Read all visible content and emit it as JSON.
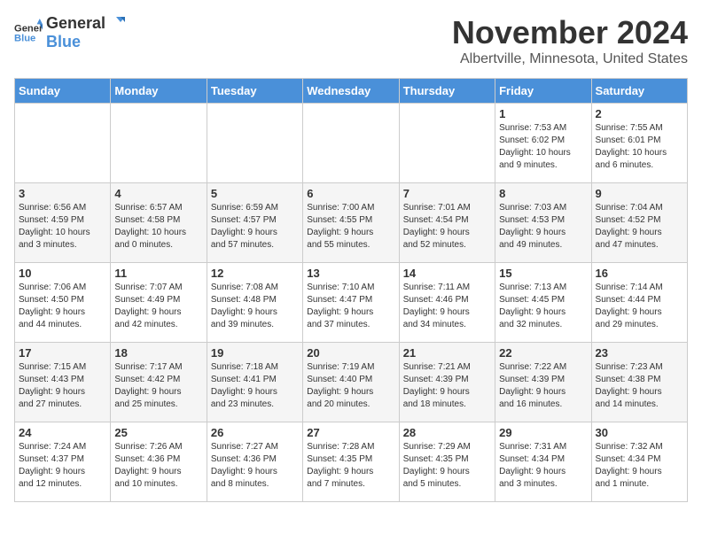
{
  "header": {
    "logo_general": "General",
    "logo_blue": "Blue",
    "month_title": "November 2024",
    "location": "Albertville, Minnesota, United States"
  },
  "days_of_week": [
    "Sunday",
    "Monday",
    "Tuesday",
    "Wednesday",
    "Thursday",
    "Friday",
    "Saturday"
  ],
  "weeks": [
    [
      {
        "day": "",
        "info": ""
      },
      {
        "day": "",
        "info": ""
      },
      {
        "day": "",
        "info": ""
      },
      {
        "day": "",
        "info": ""
      },
      {
        "day": "",
        "info": ""
      },
      {
        "day": "1",
        "info": "Sunrise: 7:53 AM\nSunset: 6:02 PM\nDaylight: 10 hours\nand 9 minutes."
      },
      {
        "day": "2",
        "info": "Sunrise: 7:55 AM\nSunset: 6:01 PM\nDaylight: 10 hours\nand 6 minutes."
      }
    ],
    [
      {
        "day": "3",
        "info": "Sunrise: 6:56 AM\nSunset: 4:59 PM\nDaylight: 10 hours\nand 3 minutes."
      },
      {
        "day": "4",
        "info": "Sunrise: 6:57 AM\nSunset: 4:58 PM\nDaylight: 10 hours\nand 0 minutes."
      },
      {
        "day": "5",
        "info": "Sunrise: 6:59 AM\nSunset: 4:57 PM\nDaylight: 9 hours\nand 57 minutes."
      },
      {
        "day": "6",
        "info": "Sunrise: 7:00 AM\nSunset: 4:55 PM\nDaylight: 9 hours\nand 55 minutes."
      },
      {
        "day": "7",
        "info": "Sunrise: 7:01 AM\nSunset: 4:54 PM\nDaylight: 9 hours\nand 52 minutes."
      },
      {
        "day": "8",
        "info": "Sunrise: 7:03 AM\nSunset: 4:53 PM\nDaylight: 9 hours\nand 49 minutes."
      },
      {
        "day": "9",
        "info": "Sunrise: 7:04 AM\nSunset: 4:52 PM\nDaylight: 9 hours\nand 47 minutes."
      }
    ],
    [
      {
        "day": "10",
        "info": "Sunrise: 7:06 AM\nSunset: 4:50 PM\nDaylight: 9 hours\nand 44 minutes."
      },
      {
        "day": "11",
        "info": "Sunrise: 7:07 AM\nSunset: 4:49 PM\nDaylight: 9 hours\nand 42 minutes."
      },
      {
        "day": "12",
        "info": "Sunrise: 7:08 AM\nSunset: 4:48 PM\nDaylight: 9 hours\nand 39 minutes."
      },
      {
        "day": "13",
        "info": "Sunrise: 7:10 AM\nSunset: 4:47 PM\nDaylight: 9 hours\nand 37 minutes."
      },
      {
        "day": "14",
        "info": "Sunrise: 7:11 AM\nSunset: 4:46 PM\nDaylight: 9 hours\nand 34 minutes."
      },
      {
        "day": "15",
        "info": "Sunrise: 7:13 AM\nSunset: 4:45 PM\nDaylight: 9 hours\nand 32 minutes."
      },
      {
        "day": "16",
        "info": "Sunrise: 7:14 AM\nSunset: 4:44 PM\nDaylight: 9 hours\nand 29 minutes."
      }
    ],
    [
      {
        "day": "17",
        "info": "Sunrise: 7:15 AM\nSunset: 4:43 PM\nDaylight: 9 hours\nand 27 minutes."
      },
      {
        "day": "18",
        "info": "Sunrise: 7:17 AM\nSunset: 4:42 PM\nDaylight: 9 hours\nand 25 minutes."
      },
      {
        "day": "19",
        "info": "Sunrise: 7:18 AM\nSunset: 4:41 PM\nDaylight: 9 hours\nand 23 minutes."
      },
      {
        "day": "20",
        "info": "Sunrise: 7:19 AM\nSunset: 4:40 PM\nDaylight: 9 hours\nand 20 minutes."
      },
      {
        "day": "21",
        "info": "Sunrise: 7:21 AM\nSunset: 4:39 PM\nDaylight: 9 hours\nand 18 minutes."
      },
      {
        "day": "22",
        "info": "Sunrise: 7:22 AM\nSunset: 4:39 PM\nDaylight: 9 hours\nand 16 minutes."
      },
      {
        "day": "23",
        "info": "Sunrise: 7:23 AM\nSunset: 4:38 PM\nDaylight: 9 hours\nand 14 minutes."
      }
    ],
    [
      {
        "day": "24",
        "info": "Sunrise: 7:24 AM\nSunset: 4:37 PM\nDaylight: 9 hours\nand 12 minutes."
      },
      {
        "day": "25",
        "info": "Sunrise: 7:26 AM\nSunset: 4:36 PM\nDaylight: 9 hours\nand 10 minutes."
      },
      {
        "day": "26",
        "info": "Sunrise: 7:27 AM\nSunset: 4:36 PM\nDaylight: 9 hours\nand 8 minutes."
      },
      {
        "day": "27",
        "info": "Sunrise: 7:28 AM\nSunset: 4:35 PM\nDaylight: 9 hours\nand 7 minutes."
      },
      {
        "day": "28",
        "info": "Sunrise: 7:29 AM\nSunset: 4:35 PM\nDaylight: 9 hours\nand 5 minutes."
      },
      {
        "day": "29",
        "info": "Sunrise: 7:31 AM\nSunset: 4:34 PM\nDaylight: 9 hours\nand 3 minutes."
      },
      {
        "day": "30",
        "info": "Sunrise: 7:32 AM\nSunset: 4:34 PM\nDaylight: 9 hours\nand 1 minute."
      }
    ]
  ]
}
